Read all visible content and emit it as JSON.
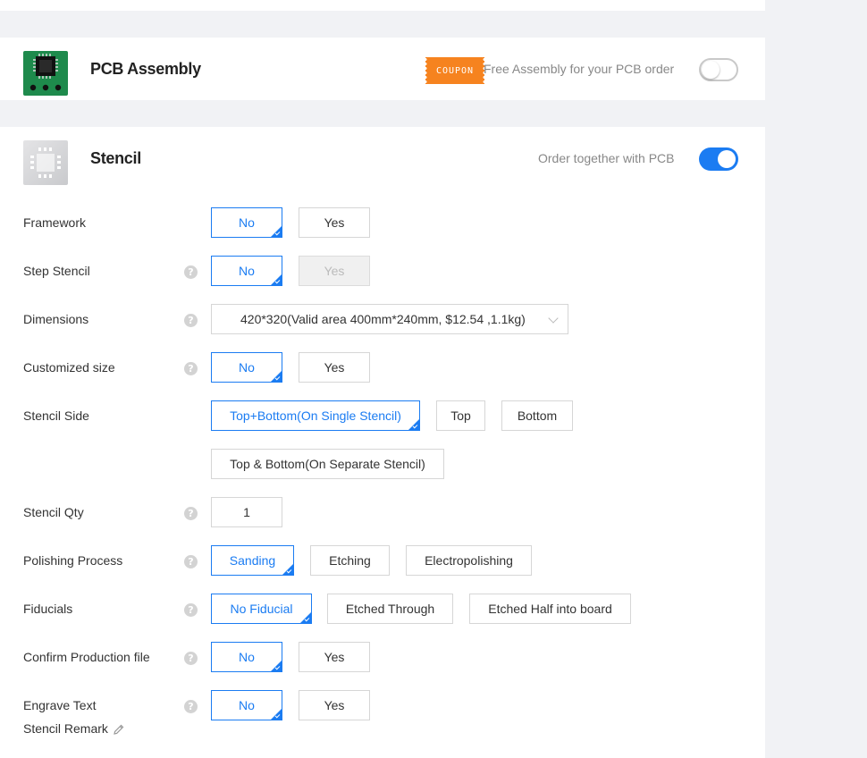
{
  "assembly": {
    "title": "PCB Assembly",
    "coupon_label": "COUPON",
    "note": "Free Assembly for your PCB order",
    "toggle_on": false
  },
  "stencil": {
    "title": "Stencil",
    "note": "Order together with PCB",
    "toggle_on": true
  },
  "rows": {
    "framework": {
      "label": "Framework",
      "options": [
        "No",
        "Yes"
      ],
      "selected": "No"
    },
    "step_stencil": {
      "label": "Step Stencil",
      "options": [
        "No",
        "Yes"
      ],
      "selected": "No",
      "disabled": "Yes"
    },
    "dimensions": {
      "label": "Dimensions",
      "value": "420*320(Valid area 400mm*240mm, $12.54 ,1.1kg)"
    },
    "customized_size": {
      "label": "Customized size",
      "options": [
        "No",
        "Yes"
      ],
      "selected": "No"
    },
    "stencil_side": {
      "label": "Stencil Side",
      "options": [
        "Top+Bottom(On Single Stencil)",
        "Top",
        "Bottom",
        "Top & Bottom(On Separate Stencil)"
      ],
      "selected": "Top+Bottom(On Single Stencil)"
    },
    "stencil_qty": {
      "label": "Stencil Qty",
      "value": "1"
    },
    "polishing": {
      "label": "Polishing Process",
      "options": [
        "Sanding",
        "Etching",
        "Electropolishing"
      ],
      "selected": "Sanding"
    },
    "fiducials": {
      "label": "Fiducials",
      "options": [
        "No Fiducial",
        "Etched Through",
        "Etched Half into board"
      ],
      "selected": "No Fiducial"
    },
    "confirm_file": {
      "label": "Confirm Production file",
      "options": [
        "No",
        "Yes"
      ],
      "selected": "No"
    },
    "engrave_text": {
      "label": "Engrave Text",
      "options": [
        "No",
        "Yes"
      ],
      "selected": "No"
    },
    "remark": {
      "label": "Stencil Remark"
    }
  },
  "help_glyph": "?",
  "colors": {
    "accent": "#1b7cf2",
    "pcb_green": "#1e8a4c",
    "coupon_orange": "#f6831f"
  }
}
